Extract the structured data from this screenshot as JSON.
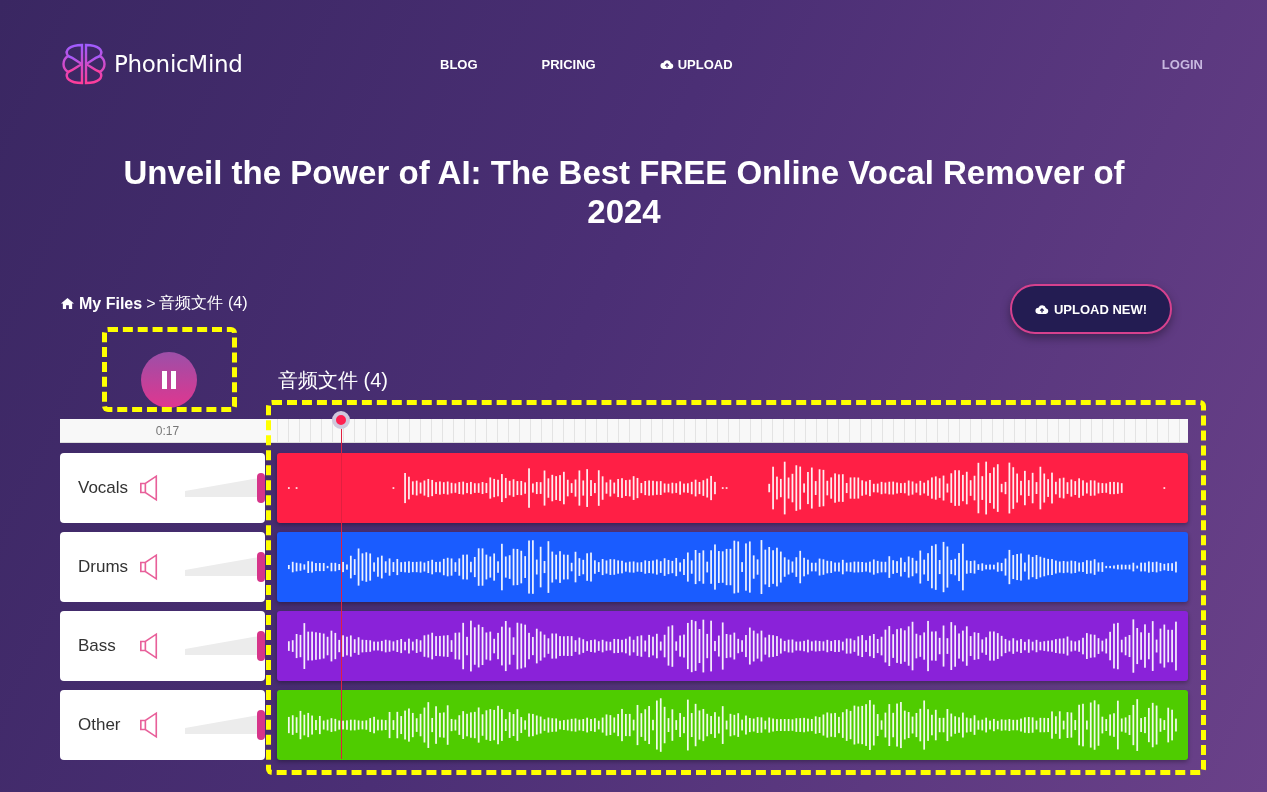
{
  "brand": {
    "name": "PhonicMind"
  },
  "nav": [
    {
      "label": "BLOG",
      "kind": "link"
    },
    {
      "label": "PRICING",
      "kind": "link"
    },
    {
      "label": "UPLOAD",
      "kind": "upload"
    }
  ],
  "login": "LOGIN",
  "headline": "Unveil the Power of AI: The Best FREE Online Vocal Remover of 2024",
  "breadcrumb": {
    "home": "My Files",
    "separator": ">",
    "current": "音频文件 (4)"
  },
  "upload_button": "UPLOAD NEW!",
  "player": {
    "playing": true,
    "title": "音频文件 (4)",
    "time": "0:17",
    "level": 0.07
  },
  "tracks": [
    {
      "name": "Vocals",
      "color": "#ff1f45",
      "level": 1
    },
    {
      "name": "Drums",
      "color": "#1a5cff",
      "level": 1
    },
    {
      "name": "Bass",
      "color": "#8a22d9",
      "level": 1
    },
    {
      "name": "Other",
      "color": "#4fcc00",
      "level": 1
    }
  ]
}
